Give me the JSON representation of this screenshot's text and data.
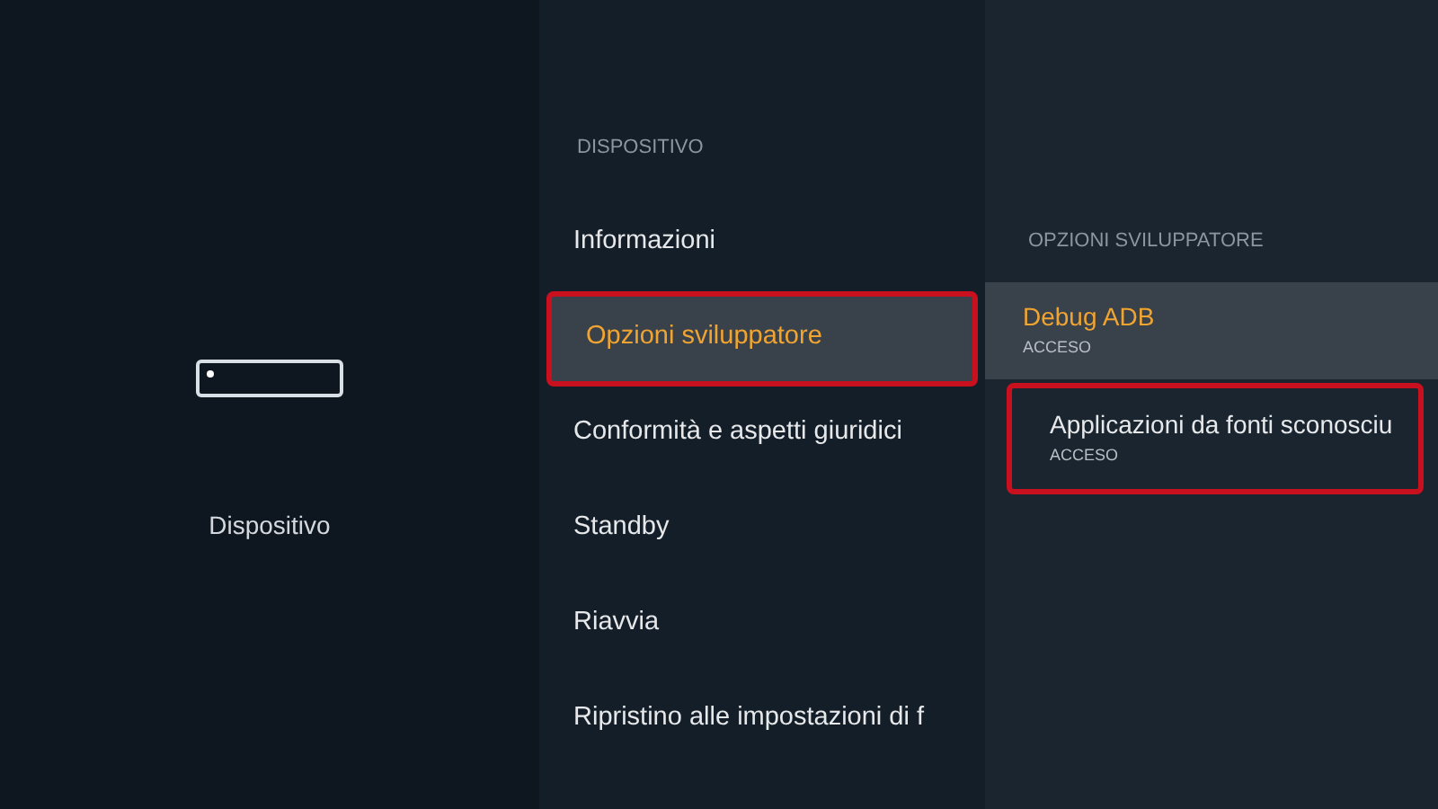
{
  "category": {
    "label": "Dispositivo"
  },
  "menu": {
    "heading": "DISPOSITIVO",
    "items": [
      {
        "label": "Informazioni",
        "selected": false,
        "highlighted": false
      },
      {
        "label": "Opzioni sviluppatore",
        "selected": true,
        "highlighted": true
      },
      {
        "label": "Conformità e aspetti giuridici",
        "selected": false,
        "highlighted": false
      },
      {
        "label": "Standby",
        "selected": false,
        "highlighted": false
      },
      {
        "label": "Riavvia",
        "selected": false,
        "highlighted": false
      },
      {
        "label": "Ripristino alle impostazioni di f",
        "selected": false,
        "highlighted": false
      }
    ]
  },
  "options": {
    "heading": "OPZIONI SVILUPPATORE",
    "items": [
      {
        "label": "Debug ADB",
        "status": "ACCESO",
        "selected": true,
        "highlighted": false
      },
      {
        "label": "Applicazioni da fonti sconosciu",
        "status": "ACCESO",
        "selected": false,
        "highlighted": true
      }
    ]
  }
}
